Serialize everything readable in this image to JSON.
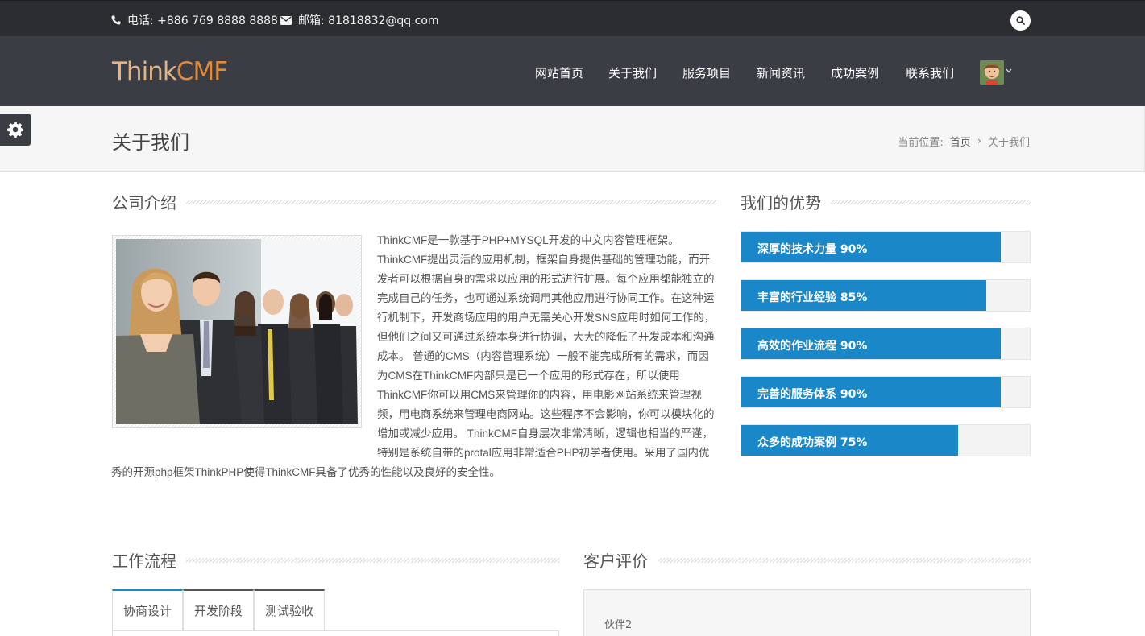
{
  "topbar": {
    "phone": "电话: +886 769 8888 8888",
    "email": "邮箱: 81818832@qq.com"
  },
  "logo": {
    "part1": "Think",
    "part2": "CMF"
  },
  "nav": {
    "items": [
      "网站首页",
      "关于我们",
      "服务项目",
      "新闻资讯",
      "成功案例",
      "联系我们"
    ]
  },
  "page": {
    "title": "关于我们",
    "breadcrumb": {
      "prefix": "当前位置:",
      "home": "首页",
      "separator": "›",
      "current": "关于我们"
    }
  },
  "intro": {
    "heading": "公司介绍",
    "text": "ThinkCMF是一款基于PHP+MYSQL开发的中文内容管理框架。ThinkCMF提出灵活的应用机制，框架自身提供基础的管理功能，而开发者可以根据自身的需求以应用的形式进行扩展。每个应用都能独立的完成自己的任务，也可通过系统调用其他应用进行协同工作。在这种运行机制下，开发商场应用的用户无需关心开发SNS应用时如何工作的，但他们之间又可通过系统本身进行协调，大大的降低了开发成本和沟通成本。 普通的CMS（内容管理系统）一般不能完成所有的需求，而因为CMS在ThinkCMF内部只是已一个应用的形式存在，所以使用ThinkCMF你可以用CMS来管理你的内容，用电影网站系统来管理视频，用电商系统来管理电商网站。这些程序不会影响，你可以模块化的增加或减少应用。 ThinkCMF自身层次非常清晰，逻辑也相当的严谨，特别是系统自带的protal应用非常适合PHP初学者使用。采用了国内优秀的开源php框架ThinkPHP使得ThinkCMF具备了优秀的性能以及良好的安全性。"
  },
  "advantages": {
    "heading": "我们的优势",
    "items": [
      {
        "label": "深厚的技术力量 90%",
        "percent": 90
      },
      {
        "label": "丰富的行业经验 85%",
        "percent": 85
      },
      {
        "label": "高效的作业流程 90%",
        "percent": 90
      },
      {
        "label": "完善的服务体系 90%",
        "percent": 90
      },
      {
        "label": "众多的成功案例 75%",
        "percent": 75
      }
    ]
  },
  "workflow": {
    "heading": "工作流程",
    "tabs": [
      "协商设计",
      "开发阶段",
      "测试验收"
    ]
  },
  "reviews": {
    "heading": "客户评价",
    "partner": "伙伴2"
  },
  "colors": {
    "accent": "#1a87c9",
    "topbar_bg": "#2b2d31",
    "navbar_bg": "#3a3d44"
  }
}
